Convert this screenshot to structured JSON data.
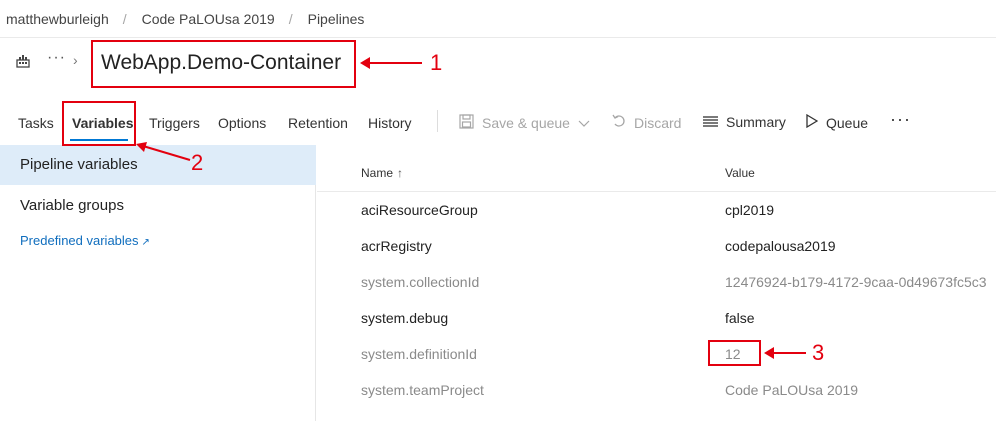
{
  "breadcrumb": {
    "items": [
      "matthewburleigh",
      "Code PaLOUsa 2019",
      "Pipelines"
    ],
    "separator": "/"
  },
  "titlebar": {
    "title": "WebApp.Demo-Container",
    "more": "···",
    "chevron": "›",
    "icon": "building-icon"
  },
  "tabs": {
    "items": [
      "Tasks",
      "Variables",
      "Triggers",
      "Options",
      "Retention",
      "History"
    ],
    "active": "Variables"
  },
  "commands": {
    "save_queue": "Save & queue",
    "discard": "Discard",
    "summary": "Summary",
    "queue": "Queue",
    "more": "···"
  },
  "left_nav": {
    "pipeline_variables": "Pipeline variables",
    "variable_groups": "Variable groups",
    "predefined_variables": "Predefined variables"
  },
  "grid": {
    "headers": {
      "name": "Name",
      "sort": "↑",
      "value": "Value"
    },
    "rows": [
      {
        "name": "aciResourceGroup",
        "value": "cpl2019",
        "readonly": false
      },
      {
        "name": "acrRegistry",
        "value": "codepalousa2019",
        "readonly": false
      },
      {
        "name": "system.collectionId",
        "value": "12476924-b179-4172-9caa-0d49673fc5c3",
        "readonly": true
      },
      {
        "name": "system.debug",
        "value": "false",
        "readonly": false
      },
      {
        "name": "system.definitionId",
        "value": "12",
        "readonly": true
      },
      {
        "name": "system.teamProject",
        "value": "Code PaLOUsa 2019",
        "readonly": true
      }
    ]
  },
  "annotations": [
    "1",
    "2",
    "3"
  ],
  "colors": {
    "accent": "#0078d4",
    "selected_bg": "#deecf9",
    "link": "#106ebe",
    "annotation": "#e3000f"
  }
}
